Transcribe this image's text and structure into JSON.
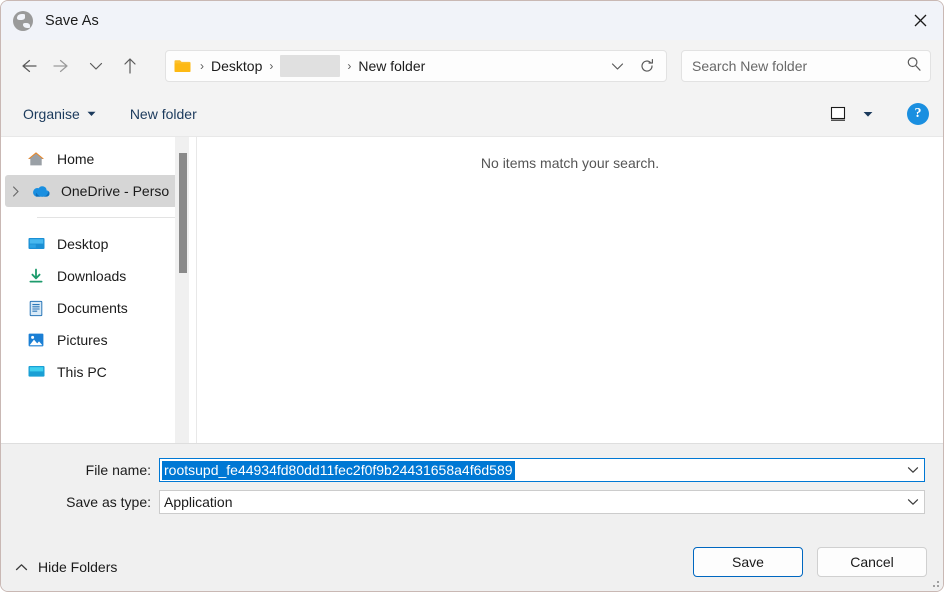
{
  "window": {
    "title": "Save As",
    "app_icon": "globe-icon",
    "close_icon": "close-icon"
  },
  "nav": {
    "back_icon": "arrow-left-icon",
    "forward_icon": "arrow-right-icon",
    "recent_icon": "chevron-down-icon",
    "up_icon": "arrow-up-icon",
    "breadcrumb": {
      "folder_icon": "folder-icon",
      "separator": "›",
      "items": [
        {
          "label": "Desktop",
          "redacted": false
        },
        {
          "label": "",
          "redacted": true
        },
        {
          "label": "New folder",
          "redacted": false
        }
      ],
      "dropdown_icon": "chevron-down-icon",
      "refresh_icon": "refresh-icon"
    },
    "search": {
      "placeholder": "Search New folder",
      "value": "",
      "icon": "search-icon"
    }
  },
  "toolbar": {
    "organise_label": "Organise",
    "organise_caret_icon": "caret-down-icon",
    "new_folder_label": "New folder",
    "view_icon": "view-mode-icon",
    "view_caret_icon": "caret-down-icon",
    "help_label": "?",
    "help_icon": "help-icon"
  },
  "sidebar": {
    "items": [
      {
        "label": "Home",
        "icon": "home-icon",
        "pinned": false,
        "expandable": false,
        "selected": false
      },
      {
        "label": "OneDrive - Perso",
        "icon": "onedrive-icon",
        "pinned": false,
        "expandable": true,
        "selected": true
      },
      {
        "divider": true
      },
      {
        "label": "Desktop",
        "icon": "desktop-icon",
        "pinned": true,
        "expandable": false,
        "selected": false
      },
      {
        "label": "Downloads",
        "icon": "downloads-icon",
        "pinned": true,
        "expandable": false,
        "selected": false
      },
      {
        "label": "Documents",
        "icon": "documents-icon",
        "pinned": true,
        "expandable": false,
        "selected": false
      },
      {
        "label": "Pictures",
        "icon": "pictures-icon",
        "pinned": true,
        "expandable": false,
        "selected": false
      },
      {
        "label": "This PC",
        "icon": "thispc-icon",
        "pinned": true,
        "expandable": false,
        "selected": false
      }
    ]
  },
  "filelist": {
    "empty_message": "No items match your search."
  },
  "form": {
    "file_name_label": "File name:",
    "file_name_value": "rootsupd_fe44934fd80dd11fec2f0f9b24431658a4f6d589",
    "file_name_selected": true,
    "save_as_type_label": "Save as type:",
    "save_as_type_value": "Application",
    "dropdown_icon": "chevron-down-icon"
  },
  "footer": {
    "hide_folders_label": "Hide Folders",
    "hide_folders_icon": "chevron-up-icon",
    "save_label": "Save",
    "cancel_label": "Cancel",
    "resize_grip_icon": "resize-grip-icon"
  },
  "colors": {
    "accent": "#0078d4",
    "default_button_border": "#0067c0",
    "titlebar_bg": "#f1f3f9",
    "chrome_bg": "#f3f3f3",
    "bottom_bg": "#f0f0f0",
    "selection_bg": "#d6d6d6"
  }
}
